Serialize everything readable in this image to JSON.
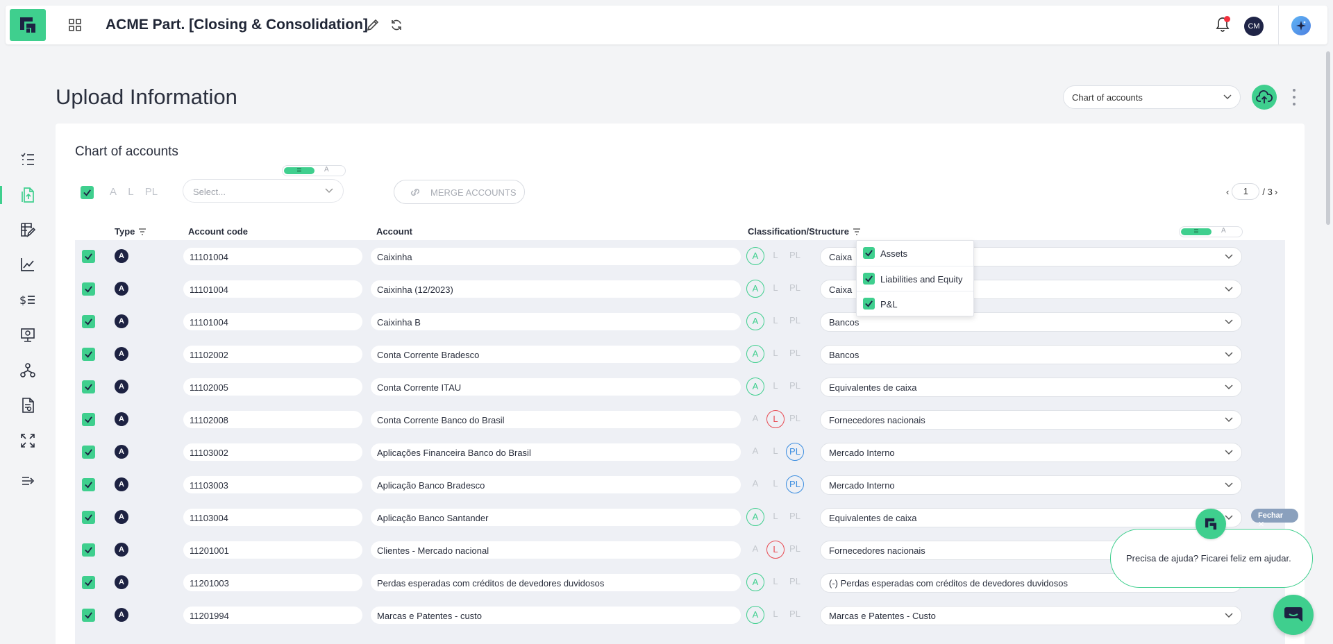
{
  "app": {
    "title": "ACME Part. [Closing & Consolidation]",
    "user_initials": "CM"
  },
  "page": {
    "title": "Upload Information",
    "dataset_select": "Chart of accounts"
  },
  "card": {
    "title": "Chart of accounts",
    "filter_letters": [
      "A",
      "L",
      "PL"
    ],
    "select_placeholder": "Select...",
    "merge_label": "MERGE ACCOUNTS",
    "toggle_off_letter": "A",
    "pager": {
      "current": "1",
      "total": "/ 3"
    }
  },
  "table": {
    "headers": {
      "type": "Type",
      "code": "Account code",
      "account": "Account",
      "classification": "Classification/Structure"
    },
    "class_letters": [
      "A",
      "L",
      "PL"
    ],
    "rows": [
      {
        "type": "A",
        "code": "11101004",
        "account": "Caixinha",
        "cls": "A",
        "structure": "Caixa"
      },
      {
        "type": "A",
        "code": "11101004",
        "account": "Caixinha (12/2023)",
        "cls": "A",
        "structure": "Caixa"
      },
      {
        "type": "A",
        "code": "11101004",
        "account": "Caixinha B",
        "cls": "A",
        "structure": "Bancos"
      },
      {
        "type": "A",
        "code": "11102002",
        "account": "Conta Corrente Bradesco",
        "cls": "A",
        "structure": "Bancos"
      },
      {
        "type": "A",
        "code": "11102005",
        "account": "Conta Corrente ITAU",
        "cls": "A",
        "structure": "Equivalentes de caixa"
      },
      {
        "type": "A",
        "code": "11102008",
        "account": "Conta Corrente Banco do Brasil",
        "cls": "L",
        "structure": "Fornecedores nacionais"
      },
      {
        "type": "A",
        "code": "11103002",
        "account": "Aplicações Financeira Banco do Brasil",
        "cls": "PL",
        "structure": "Mercado Interno"
      },
      {
        "type": "A",
        "code": "11103003",
        "account": "Aplicação Banco Bradesco",
        "cls": "PL",
        "structure": "Mercado Interno"
      },
      {
        "type": "A",
        "code": "11103004",
        "account": "Aplicação Banco Santander",
        "cls": "A",
        "structure": "Equivalentes de caixa"
      },
      {
        "type": "A",
        "code": "11201001",
        "account": "Clientes - Mercado nacional",
        "cls": "L",
        "structure": "Fornecedores nacionais"
      },
      {
        "type": "A",
        "code": "11201003",
        "account": "Perdas esperadas com créditos de devedores duvidosos",
        "cls": "A",
        "structure": "(-) Perdas esperadas com créditos de devedores duvidosos"
      },
      {
        "type": "A",
        "code": "11201994",
        "account": "Marcas e Patentes - custo",
        "cls": "A",
        "structure": "Marcas e Patentes - Custo"
      }
    ]
  },
  "dropdown": {
    "items": [
      "Assets",
      "Liabilities and Equity",
      "P&L"
    ]
  },
  "chat": {
    "close_label": "Fechar ✕",
    "message": "Precisa de ajuda? Ficarei feliz em ajudar."
  },
  "colors": {
    "brand": "#3fcf8e",
    "navy": "#1d2242",
    "liability": "#e84a52",
    "pl": "#3b8de0"
  }
}
